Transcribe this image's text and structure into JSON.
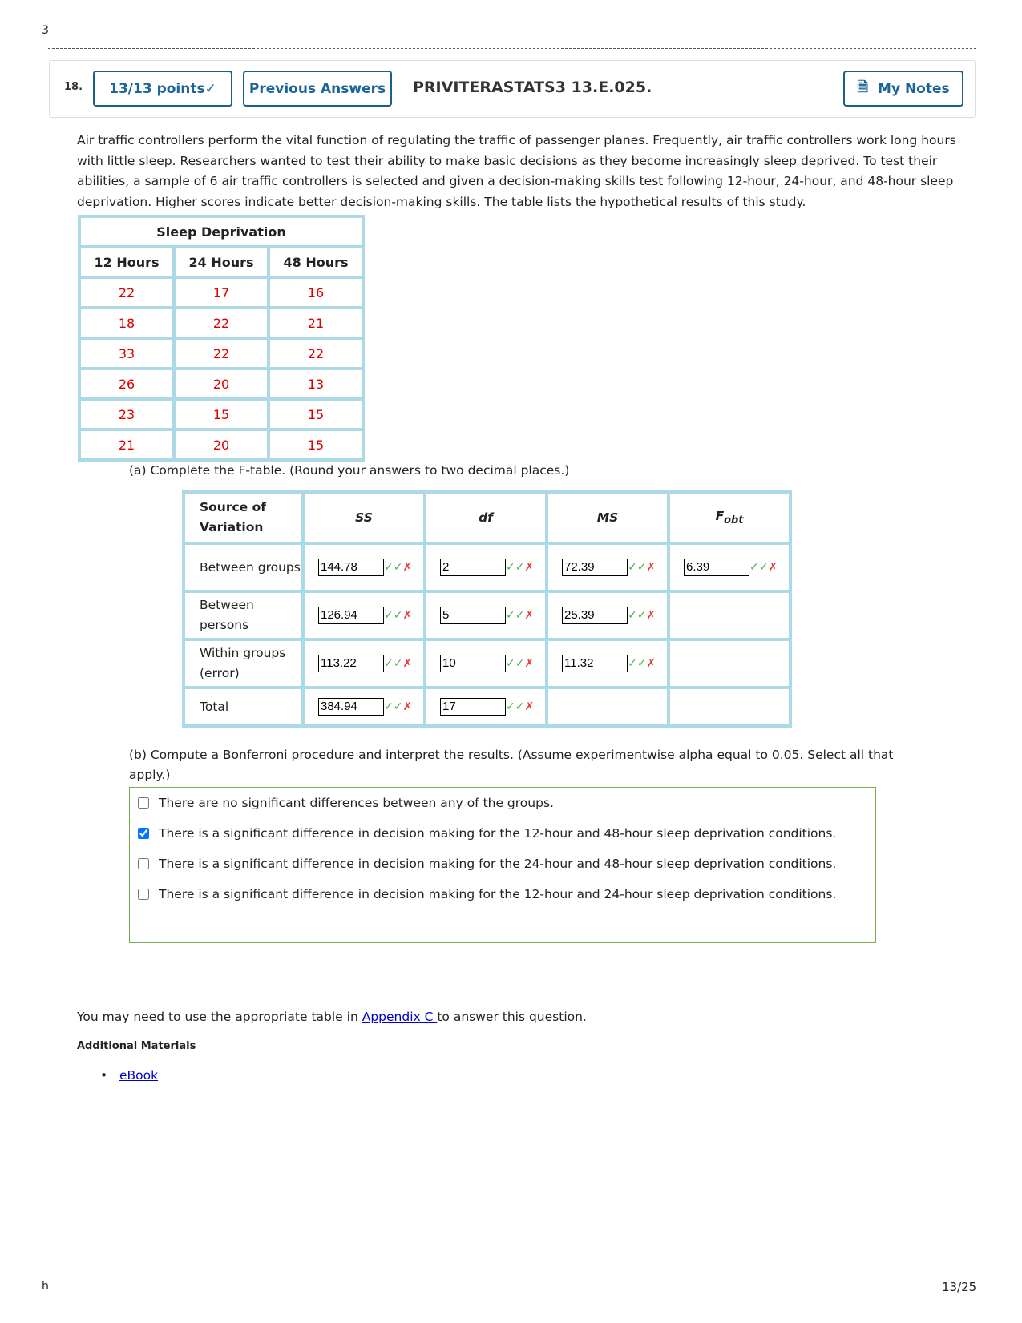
{
  "header": {
    "page_marker": "3",
    "question_number": "18.",
    "points": "13/13 points",
    "points_icon": "check-icon",
    "previous_answers": "Previous Answers",
    "problem_id": "PRIVITERASTATS3 13.E.025.",
    "my_notes": "My Notes",
    "notes_icon": "document-icon"
  },
  "question": {
    "text": "Air traffic controllers perform the vital function of regulating the traffic of passenger planes. Frequently, air traffic controllers work long hours with little sleep. Researchers wanted to test their ability to make basic decisions as they become increasingly sleep deprived. To test their abilities, a sample of 6 air traffic controllers is selected and given a decision-making skills test following 12-hour, 24-hour, and 48-hour sleep deprivation. Higher scores indicate better decision-making skills. The table lists the hypothetical results of this study."
  },
  "data_table": {
    "title": "Sleep Deprivation",
    "columns": [
      "12 Hours",
      "24 Hours",
      "48 Hours"
    ],
    "rows": [
      [
        "22",
        "17",
        "16"
      ],
      [
        "18",
        "22",
        "21"
      ],
      [
        "33",
        "22",
        "22"
      ],
      [
        "26",
        "20",
        "13"
      ],
      [
        "23",
        "15",
        "15"
      ],
      [
        "21",
        "20",
        "15"
      ]
    ],
    "value_color": "#dd0000"
  },
  "part_a": {
    "prompt": "(a) Complete the F-table. (Round your answers to two decimal places.)",
    "headers": [
      "Source of Variation",
      "SS",
      "df",
      "MS",
      "F"
    ],
    "f_subscript": "obt",
    "rows": [
      {
        "source": "Between groups",
        "ss": "144.78",
        "df": "2",
        "ms": "72.39",
        "f": "6.39"
      },
      {
        "source": "Between persons",
        "ss": "126.94",
        "df": "5",
        "ms": "25.39"
      },
      {
        "source": "Within groups (error)",
        "ss": "113.22",
        "df": "10",
        "ms": "11.32"
      },
      {
        "source": "Total",
        "ss": "384.94",
        "df": "17"
      }
    ]
  },
  "part_b": {
    "prompt": "(b) Compute a Bonferroni procedure and interpret the results. (Assume experimentwise alpha equal to 0.05. Select all that apply.)",
    "options": [
      {
        "label": "There are no significant differences between any of the groups.",
        "checked": false
      },
      {
        "label": "There is a significant difference in decision making for the 12-hour and 48-hour sleep deprivation conditions.",
        "checked": true
      },
      {
        "label": "There is a significant difference in decision making for the 24-hour and 48-hour sleep deprivation conditions.",
        "checked": false
      },
      {
        "label": "There is a significant difference in decision making for the 12-hour and 24-hour sleep deprivation conditions.",
        "checked": false
      }
    ]
  },
  "footer": {
    "note_before": "You may need to use the appropriate table in ",
    "appendix_link": "Appendix C ",
    "note_after": "to answer this question.",
    "additional_materials": "Additional Materials",
    "ebook": "eBook",
    "page_left": "h",
    "page_number": "13/25"
  }
}
